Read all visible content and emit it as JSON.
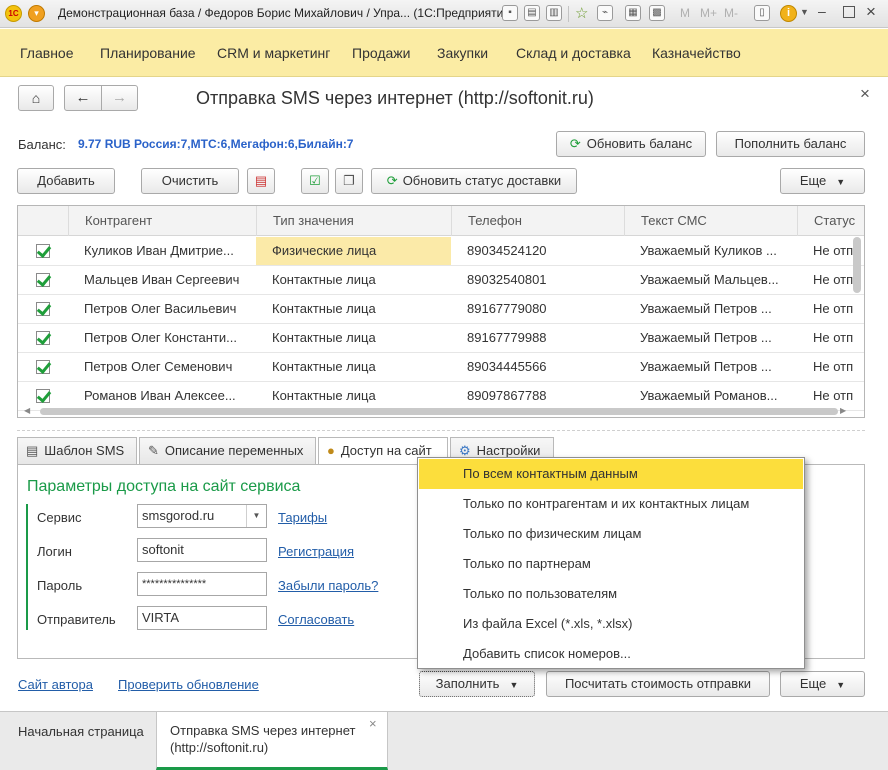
{
  "window": {
    "title": "Демонстрационная база / Федоров Борис Михайлович / Упра...  (1С:Предприятие)",
    "toolbar_marks": [
      "M",
      "M+",
      "M-"
    ],
    "colors": {
      "menu_bg": "#fbeca4",
      "accent_green": "#1f9e3a",
      "balance_blue": "#2a62c9",
      "highlight": "#fcde3c"
    }
  },
  "menu": [
    "Главное",
    "Планирование",
    "CRM и маркетинг",
    "Продажи",
    "Закупки",
    "Склад и доставка",
    "Казначейство"
  ],
  "form": {
    "title": "Отправка SMS через интернет (http://softonit.ru)",
    "close": "×",
    "balance_label": "Баланс:",
    "balance_value": "9.77 RUB Россия:7,МТС:6,Мегафон:6,Билайн:7",
    "refresh_balance": "Обновить баланс",
    "topup_balance": "Пополнить баланс",
    "add": "Добавить",
    "clear": "Очистить",
    "refresh_status": "Обновить статус доставки",
    "more": "Еще"
  },
  "table": {
    "columns": [
      "Контрагент",
      "Тип значения",
      "Телефон",
      "Текст СМС",
      "Статус"
    ],
    "rows": [
      {
        "name": "Куликов Иван Дмитрие...",
        "type": "Физические лица",
        "phone": "89034524120",
        "text": "Уважаемый Куликов ...",
        "status": "Не отп"
      },
      {
        "name": "Мальцев Иван Сергеевич",
        "type": "Контактные лица",
        "phone": "89032540801",
        "text": "Уважаемый Мальцев...",
        "status": "Не отп"
      },
      {
        "name": "Петров Олег Васильевич",
        "type": "Контактные лица",
        "phone": "89167779080",
        "text": "Уважаемый Петров ...",
        "status": "Не отп"
      },
      {
        "name": "Петров Олег Константи...",
        "type": "Контактные лица",
        "phone": "89167779988",
        "text": "Уважаемый Петров ...",
        "status": "Не отп"
      },
      {
        "name": "Петров Олег Семенович",
        "type": "Контактные лица",
        "phone": "89034445566",
        "text": "Уважаемый Петров ...",
        "status": "Не отп"
      },
      {
        "name": "Романов Иван Алексее...",
        "type": "Контактные лица",
        "phone": "89097867788",
        "text": "Уважаемый Романов...",
        "status": "Не отп"
      }
    ]
  },
  "tabs": [
    "Шаблон SMS",
    "Описание переменных",
    "Доступ на сайт",
    "Настройки"
  ],
  "access": {
    "heading": "Параметры доступа на сайт сервиса",
    "service_label": "Сервис",
    "service_value": "smsgorod.ru",
    "tariffs": "Тарифы",
    "login_label": "Логин",
    "login_value": "softonit",
    "register": "Регистрация",
    "password_label": "Пароль",
    "password_value": "***************",
    "forgot": "Забыли пароль?",
    "sender_label": "Отправитель",
    "sender_value": "VIRTA",
    "agree": "Согласовать"
  },
  "popup": [
    "По всем контактным данным",
    "Только по контрагентам и их контактных лицам",
    "Только по физическим лицам",
    "Только по партнерам",
    "Только по пользователям",
    "Из файла Excel (*.xls, *.xlsx)",
    "Добавить список номеров..."
  ],
  "footer": {
    "author_site": "Сайт автора",
    "check_update": "Проверить обновление",
    "fill": "Заполнить",
    "calc_cost": "Посчитать стоимость отправки",
    "more": "Еще"
  },
  "taskbar": {
    "home": "Начальная страница",
    "current_line1": "Отправка SMS через интернет",
    "current_line2": "(http://softonit.ru)",
    "close": "×"
  }
}
